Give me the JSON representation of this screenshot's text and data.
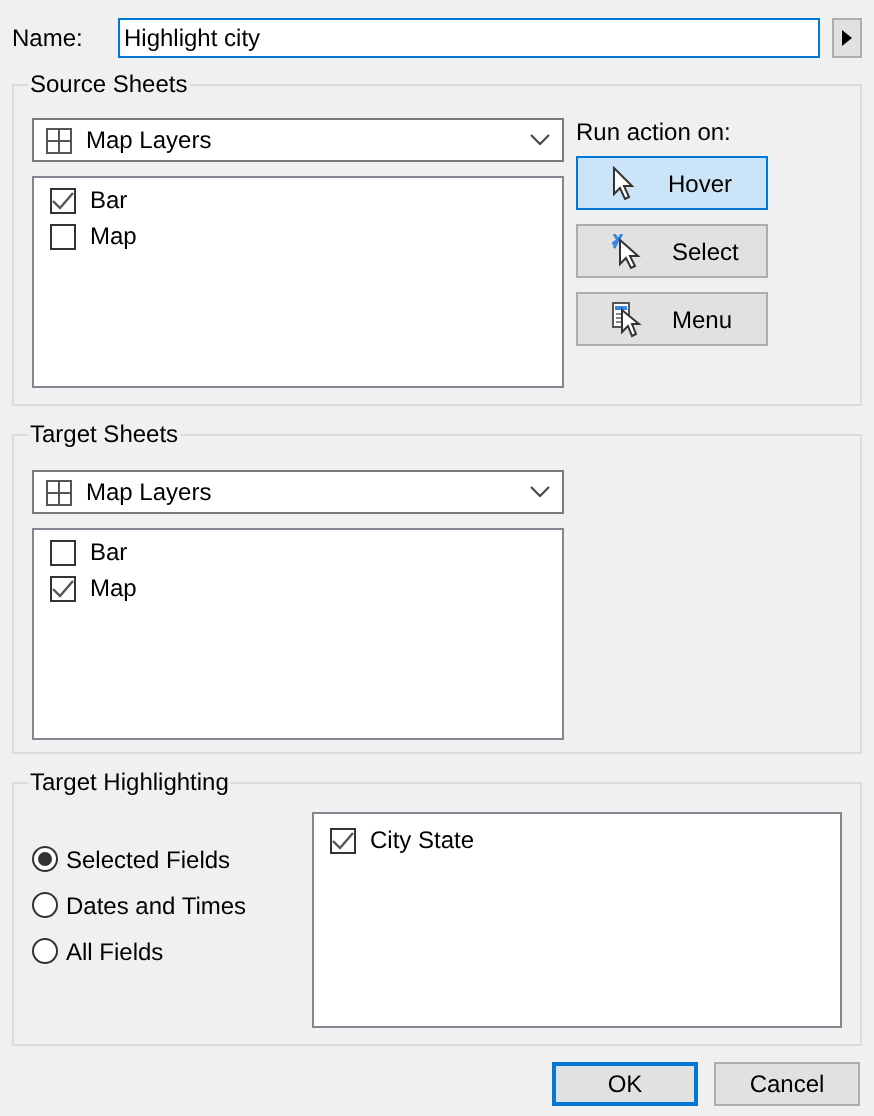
{
  "name_field": {
    "label": "Name:",
    "value": "Highlight city"
  },
  "source_sheets": {
    "title": "Source Sheets",
    "dropdown": "Map Layers",
    "items": [
      {
        "label": "Bar",
        "checked": true
      },
      {
        "label": "Map",
        "checked": false
      }
    ],
    "run_action_label": "Run action on:",
    "run_actions": [
      {
        "label": "Hover",
        "kind": "hover",
        "selected": true
      },
      {
        "label": "Select",
        "kind": "select",
        "selected": false
      },
      {
        "label": "Menu",
        "kind": "menu",
        "selected": false
      }
    ]
  },
  "target_sheets": {
    "title": "Target Sheets",
    "dropdown": "Map Layers",
    "items": [
      {
        "label": "Bar",
        "checked": false
      },
      {
        "label": "Map",
        "checked": true
      }
    ]
  },
  "target_highlighting": {
    "title": "Target Highlighting",
    "options": [
      {
        "label": "Selected Fields",
        "selected": true
      },
      {
        "label": "Dates and Times",
        "selected": false
      },
      {
        "label": "All Fields",
        "selected": false
      }
    ],
    "fields": [
      {
        "label": "City State",
        "checked": true
      }
    ]
  },
  "buttons": [
    {
      "label": "OK",
      "kind": "default"
    },
    {
      "label": "Cancel",
      "kind": "normal"
    }
  ]
}
